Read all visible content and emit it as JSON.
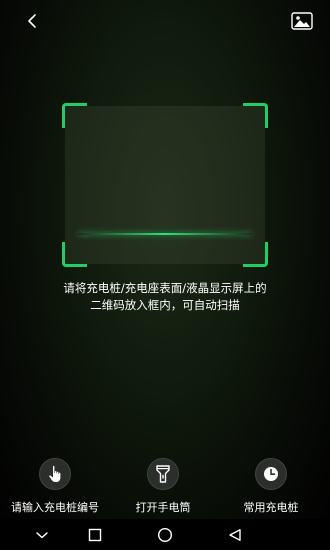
{
  "top_bar": {
    "back_icon": "chevron-left-icon",
    "album_icon": "image-icon"
  },
  "scan": {
    "accent_color": "#22cc66",
    "hint_line1": "请将充电桩/充电座表面/液晶显示屏上的",
    "hint_line2": "二维码放入框内，可自动扫描"
  },
  "actions": [
    {
      "label": "请输入充电桩编号",
      "icon": "hand-pointer-icon"
    },
    {
      "label": "打开手电筒",
      "icon": "flashlight-icon"
    },
    {
      "label": "常用充电桩",
      "icon": "clock-icon"
    }
  ],
  "nav_bar": {
    "buttons": [
      "dropdown-icon",
      "recent-apps-icon",
      "home-icon",
      "back-icon"
    ]
  }
}
